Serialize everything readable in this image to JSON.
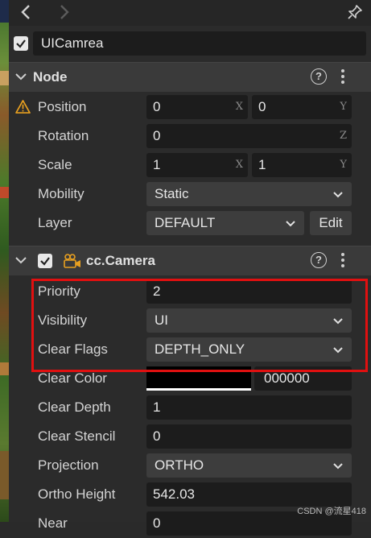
{
  "node_name": "UICamrea",
  "node_section": {
    "title": "Node",
    "position": {
      "label": "Position",
      "x": "0",
      "x_unit": "X",
      "y": "0",
      "y_unit": "Y"
    },
    "rotation": {
      "label": "Rotation",
      "z": "0",
      "z_unit": "Z"
    },
    "scale": {
      "label": "Scale",
      "x": "1",
      "x_unit": "X",
      "y": "1",
      "y_unit": "Y"
    },
    "mobility": {
      "label": "Mobility",
      "value": "Static"
    },
    "layer": {
      "label": "Layer",
      "value": "DEFAULT",
      "edit_label": "Edit"
    }
  },
  "camera_section": {
    "title": "cc.Camera",
    "priority": {
      "label": "Priority",
      "value": "2"
    },
    "visibility": {
      "label": "Visibility",
      "value": "UI"
    },
    "clear_flags": {
      "label": "Clear Flags",
      "value": "DEPTH_ONLY"
    },
    "clear_color": {
      "label": "Clear Color",
      "hex": "000000",
      "swatch": "#000000"
    },
    "clear_depth": {
      "label": "Clear Depth",
      "value": "1"
    },
    "clear_stencil": {
      "label": "Clear Stencil",
      "value": "0"
    },
    "projection": {
      "label": "Projection",
      "value": "ORTHO"
    },
    "ortho_height": {
      "label": "Ortho Height",
      "value": "542.03"
    },
    "near": {
      "label": "Near",
      "value": "0"
    }
  },
  "icons": {
    "back": "chevron-left-icon",
    "forward": "chevron-right-icon",
    "pin": "pin-icon",
    "warning": "warning-icon",
    "camera": "camera-icon",
    "help": "help-icon",
    "more": "more-vertical-icon"
  },
  "help_symbol": "?",
  "watermark": "CSDN @流星418",
  "colors": {
    "highlight": "#e01010",
    "warning": "#e8a020",
    "camera": "#e8a020"
  }
}
